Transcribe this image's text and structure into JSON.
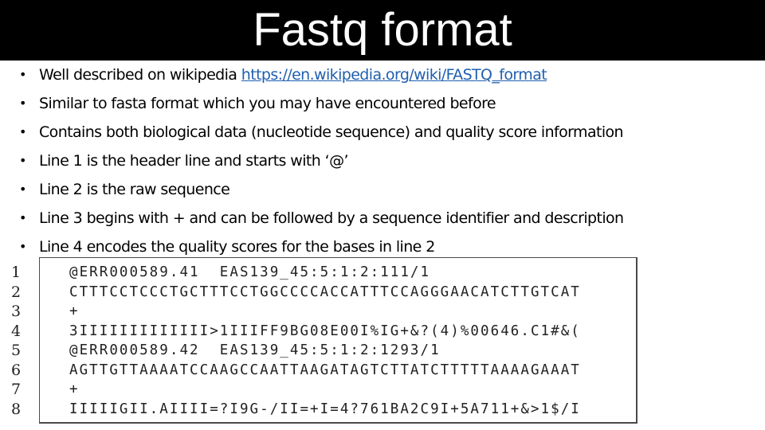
{
  "slide": {
    "title": "Fastq format",
    "bullets": [
      {
        "text": "Well described on wikipedia ",
        "link": "https://en.wikipedia.org/wiki/FASTQ_format"
      },
      {
        "text": "Similar to fasta format which you may have encountered before"
      },
      {
        "text": "Contains both biological data (nucleotide sequence) and quality score information"
      },
      {
        "text": "Line 1 is the header line and starts with ‘@’"
      },
      {
        "text": "Line 2 is the raw sequence"
      },
      {
        "text": "Line 3 begins with + and can be followed by a sequence identifier and description"
      },
      {
        "text": "Line 4 encodes the quality scores for the bases in line 2"
      }
    ],
    "bullet_symbol": "•",
    "colors": {
      "title_bar": "#000000",
      "title_text": "#ffffff",
      "link": "#1f5fb0"
    }
  },
  "code_example": {
    "line_numbers": [
      "1",
      "2",
      "3",
      "4",
      "5",
      "6",
      "7",
      "8"
    ],
    "lines": [
      "@ERR000589.41  EAS139_45:5:1:2:111/1",
      "CTTTCCTCCCTGCTTTCCTGGCCCCACCATTTCCAGGGAACATCTTGTCAT",
      "+",
      "3IIIIIIIIIIIII>1IIIFF9BG08E00I%IG+&?(4)%00646.C1#&(",
      "@ERR000589.42  EAS139_45:5:1:2:1293/1",
      "AGTTGTTAAAATCCAAGCCAATTAAGATAGTCTTATCTTTTTAAAAGAAAT",
      "+",
      "IIIIIGII.AIIII=?I9G-/II=+I=4?761BA2C9I+5A711+&>1$/I"
    ]
  }
}
